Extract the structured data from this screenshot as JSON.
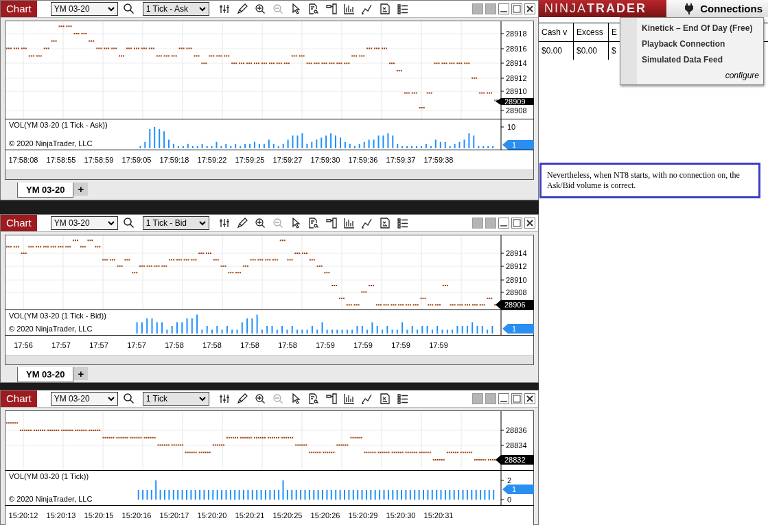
{
  "charts": [
    {
      "title": "Chart",
      "instrument": "YM 03-20",
      "interval": "1 Tick - Ask",
      "zoom_out_disabled": true,
      "price_axis": {
        "labels": [
          "28918",
          "28916",
          "28914",
          "28912",
          "28910",
          "28908"
        ],
        "last_price": "28909"
      },
      "volume_axis": {
        "label": "VOL(YM 03-20 (1 Tick - Ask))",
        "copyright": "© 2020 NinjaTrader, LLC",
        "labels": [
          "10"
        ],
        "marker": "1"
      },
      "time_labels": [
        "17:58:08",
        "17:58:55",
        "17:58:59",
        "17:59:05",
        "17:59:18",
        "17:59:22",
        "17:59:25",
        "17:59:27",
        "17:59:30",
        "17:59:36",
        "17:59:37",
        "17:59:38"
      ],
      "tabs": [
        {
          "label": "YM 03-20",
          "selected": true
        }
      ],
      "add_tab": "+"
    },
    {
      "title": "Chart",
      "instrument": "YM 03-20",
      "interval": "1 Tick - Bid",
      "zoom_out_disabled": true,
      "price_axis": {
        "labels": [
          "28914",
          "28912",
          "28910",
          "28908"
        ],
        "last_price": "28906"
      },
      "volume_axis": {
        "label": "VOL(YM 03-20 (1 Tick - Bid))",
        "copyright": "© 2020 NinjaTrader, LLC",
        "marker": "1"
      },
      "time_labels": [
        "17:56",
        "17:57",
        "17:57",
        "17:57",
        "17:58",
        "17:58",
        "17:58",
        "17:58",
        "17:59",
        "17:59",
        "17:59",
        "17:59"
      ],
      "tabs": [
        {
          "label": "YM 03-20",
          "selected": true
        }
      ],
      "add_tab": "+"
    },
    {
      "title": "Chart",
      "instrument": "YM 03-20",
      "interval": "1 Tick",
      "zoom_out_disabled": true,
      "price_axis": {
        "labels": [
          "28836",
          "28834"
        ],
        "last_price": "28832"
      },
      "volume_axis": {
        "label": "VOL(YM 03-20 (1 Tick))",
        "copyright": "© 2020 NinjaTrader, LLC",
        "labels": [
          "2",
          "0"
        ],
        "marker": "1"
      },
      "time_labels": [
        "15:20:12",
        "15:20:13",
        "15:20:15",
        "15:20:16",
        "15:20:17",
        "15:20:20",
        "15:20:21",
        "15:20:25",
        "15:20:26",
        "15:20:29",
        "15:20:30",
        "15:20:31"
      ]
    }
  ],
  "control_center": {
    "logo": "NINJA**TRADER**",
    "connections_button": "Connections",
    "table": {
      "columns": [
        "Cash v",
        "Excess",
        "E"
      ],
      "rows": [
        [
          "$0.00",
          "$0.00",
          "$"
        ]
      ]
    },
    "connections_menu": {
      "items": [
        "Kinetick – End Of Day (Free)",
        "Playback Connection",
        "Simulated Data Feed"
      ],
      "configure": "configure"
    }
  },
  "note": "Nevertheless, when NT8 starts, with no connection on, the Ask/Bid volume is correct."
}
